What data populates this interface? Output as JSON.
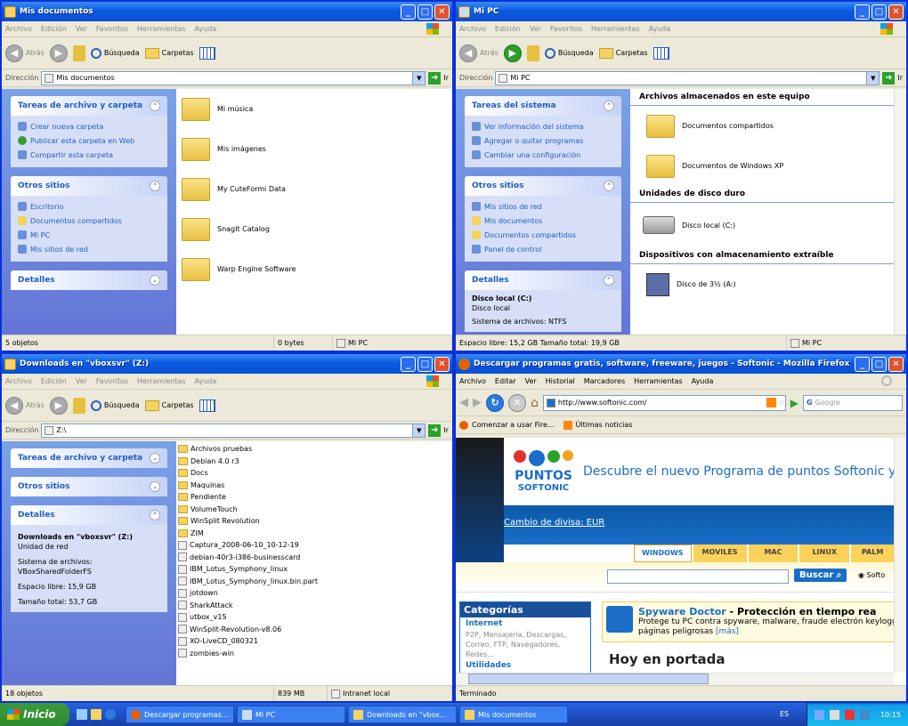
{
  "windows": {
    "w1": {
      "title": "Mis documentos",
      "menu": [
        "Archivo",
        "Edición",
        "Ver",
        "Favoritos",
        "Herramientas",
        "Ayuda"
      ],
      "toolbar": {
        "back": "Atrás",
        "search": "Búsqueda",
        "folders": "Carpetas"
      },
      "address_label": "Dirección",
      "address": "Mis documentos",
      "go": "Ir",
      "panels": [
        {
          "title": "Tareas de archivo y carpeta",
          "items": [
            "Crear nueva carpeta",
            "Publicar esta carpeta en Web",
            "Compartir esta carpeta"
          ]
        },
        {
          "title": "Otros sitios",
          "items": [
            "Escritorio",
            "Documentos compartidos",
            "Mi PC",
            "Mis sitios de red"
          ]
        },
        {
          "title": "Detalles",
          "items": []
        }
      ],
      "files": [
        "Mi música",
        "Mis imágenes",
        "My CuteFormi Data",
        "SnagIt Catalog",
        "Warp Engine Software"
      ],
      "status": [
        "5 objetos",
        "0 bytes",
        "Mi PC"
      ]
    },
    "w2": {
      "title": "Mi PC",
      "menu": [
        "Archivo",
        "Edición",
        "Ver",
        "Favoritos",
        "Herramientas",
        "Ayuda"
      ],
      "toolbar": {
        "back": "Atrás",
        "search": "Búsqueda",
        "folders": "Carpetas"
      },
      "address_label": "Dirección",
      "address": "Mi PC",
      "go": "Ir",
      "panels": [
        {
          "title": "Tareas del sistema",
          "items": [
            "Ver información del sistema",
            "Agregar o quitar programas",
            "Cambiar una configuración"
          ]
        },
        {
          "title": "Otros sitios",
          "items": [
            "Mis sitios de red",
            "Mis documentos",
            "Documentos compartidos",
            "Panel de control"
          ]
        }
      ],
      "details": {
        "title": "Detalles",
        "name": "Disco local (C:)",
        "type": "Disco local",
        "fs": "Sistema de archivos: NTFS"
      },
      "sections": [
        {
          "title": "Archivos almacenados en este equipo",
          "items": [
            "Documentos compartidos",
            "Documentos de Windows XP"
          ]
        },
        {
          "title": "Unidades de disco duro",
          "items": [
            "Disco local (C:)"
          ]
        },
        {
          "title": "Dispositivos con almacenamiento extraíble",
          "items": [
            "Disco de 3½ (A:)"
          ]
        }
      ],
      "status": [
        "Espacio libre: 15,2 GB Tamaño total: 19,9 GB",
        "Mi PC"
      ]
    },
    "w3": {
      "title": "Downloads en \"vboxsvr\" (Z:)",
      "menu": [
        "Archivo",
        "Edición",
        "Ver",
        "Favoritos",
        "Herramientas",
        "Ayuda"
      ],
      "toolbar": {
        "back": "Atrás",
        "search": "Búsqueda",
        "folders": "Carpetas"
      },
      "address_label": "Dirección",
      "address": "Z:\\",
      "go": "Ir",
      "panels": [
        {
          "title": "Tareas de archivo y carpeta"
        },
        {
          "title": "Otros sitios"
        }
      ],
      "details": {
        "title": "Detalles",
        "name": "Downloads en \"vboxsvr\" (Z:)",
        "type": "Unidad de red",
        "fs1": "Sistema de archivos:",
        "fs2": "VBoxSharedFolderFS",
        "free": "Espacio libre: 15,9 GB",
        "total": "Tamaño total: 53,7 GB"
      },
      "files": [
        "Archivos pruebas",
        "Debian 4.0 r3",
        "Docs",
        "Maquinas",
        "Pendiente",
        "VolumeTouch",
        "WinSplit Revolution",
        "ZIM",
        "Captura_2008-06-10_10-12-19",
        "debian-40r3-i386-businesscard",
        "IBM_Lotus_Symphony_linux",
        "IBM_Lotus_Symphony_linux.bin.part",
        "jotdown",
        "SharkAttack",
        "utbox_v15",
        "WinSplit-Revolution-v8.06",
        "XO-LiveCD_080321",
        "zombies-win"
      ],
      "folder_count": 8,
      "status": [
        "18 objetos",
        "839 MB",
        "Intranet local"
      ]
    },
    "w4": {
      "title": "Descargar programas gratis, software, freeware, juegos - Softonic - Mozilla Firefox",
      "menu": [
        "Archivo",
        "Editar",
        "Ver",
        "Historial",
        "Marcadores",
        "Herramientas",
        "Ayuda"
      ],
      "url": "http://www.softonic.com/",
      "search_placeholder": "Google",
      "bookmarks": [
        "Comenzar a usar Fire...",
        "Últimas noticias"
      ],
      "banner": {
        "logo1": "PUNTOS",
        "logo2": "SOFTONIC",
        "text": "Descubre el nuevo Programa de puntos Softonic y..."
      },
      "currency": "Cambio de divisa: EUR",
      "tabs": [
        "WINDOWS",
        "MOVILES",
        "MAC",
        "LINUX",
        "PALM"
      ],
      "search_btn": "Buscar",
      "search_opt": "Softo",
      "categories": {
        "title": "Categorías",
        "c1": "Internet",
        "c1sub": "P2P, Mensajería, Descargas, Correo, FTP, Navegadores, Redes...",
        "c2": "Utilidades"
      },
      "promo": {
        "name": "Spyware Doctor",
        "dash": " - Protección en tiempo rea",
        "desc": "Protege tu PC contra spyware, malware, fraude electrón keyloggers y páginas peligrosas",
        "more": "[más]"
      },
      "headline": "Hoy en portada",
      "status": "Terminado"
    }
  },
  "taskbar": {
    "start": "Inicio",
    "tasks": [
      "Descargar programas...",
      "Mi PC",
      "Downloads en \"vbox...",
      "Mis documentos"
    ],
    "lang": "ES",
    "clock": "10:15"
  },
  "colors": {
    "titlebar": "#0a5be0",
    "taskpane": "#6375d6",
    "link": "#215dc6",
    "softonic": "#1a6ec8"
  }
}
